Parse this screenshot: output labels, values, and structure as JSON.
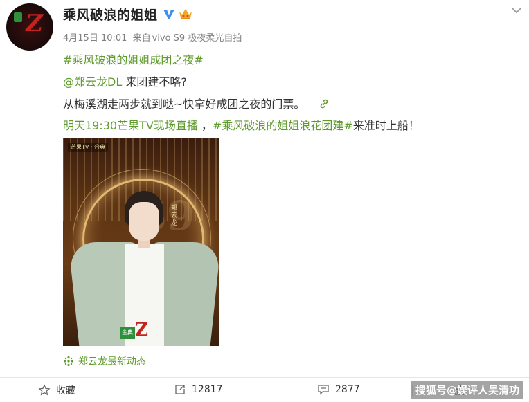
{
  "post": {
    "author": "乘风破浪的姐姐",
    "time": "4月15日 10:01",
    "source_prefix": "来自",
    "source_device": "vivo S9 极夜柔光自拍",
    "hashtag_line": "#乘风破浪的姐姐成团之夜#",
    "mention": "@郑云龙DL",
    "mention_rest": " 来团建不咯?",
    "body_line": "从梅溪湖走两步就到哒~快拿好成团之夜的门票。",
    "live_text": "明天19:30芒果TV现场直播",
    "live_sep": " ，",
    "live_hashtag": "#乘风破浪的姐姐浪花团建#",
    "live_tail": "来准时上船！",
    "poster": {
      "corner_tag": "芒果TV · 合典",
      "vertical_name": "郑云龙",
      "logo_box": "金典"
    },
    "topic_card": "郑云龙最新动态"
  },
  "actions": {
    "favorite_label": "收藏",
    "repost_count": "12817",
    "comment_count": "2877",
    "like_count": ""
  },
  "watermark": "搜狐号@娱评人吴清功",
  "icons": {
    "verified": "verified-badge-icon",
    "vip": "vip-crown-icon",
    "chevron": "chevron-down-icon",
    "link": "link-icon",
    "topic": "topic-sparkle-icon",
    "star": "star-icon",
    "repost": "repost-icon",
    "comment": "comment-icon",
    "like": "like-icon"
  },
  "colors": {
    "link_green": "#5e9b2c",
    "verified_blue": "#3b8ff0",
    "meta_gray": "#808080"
  }
}
